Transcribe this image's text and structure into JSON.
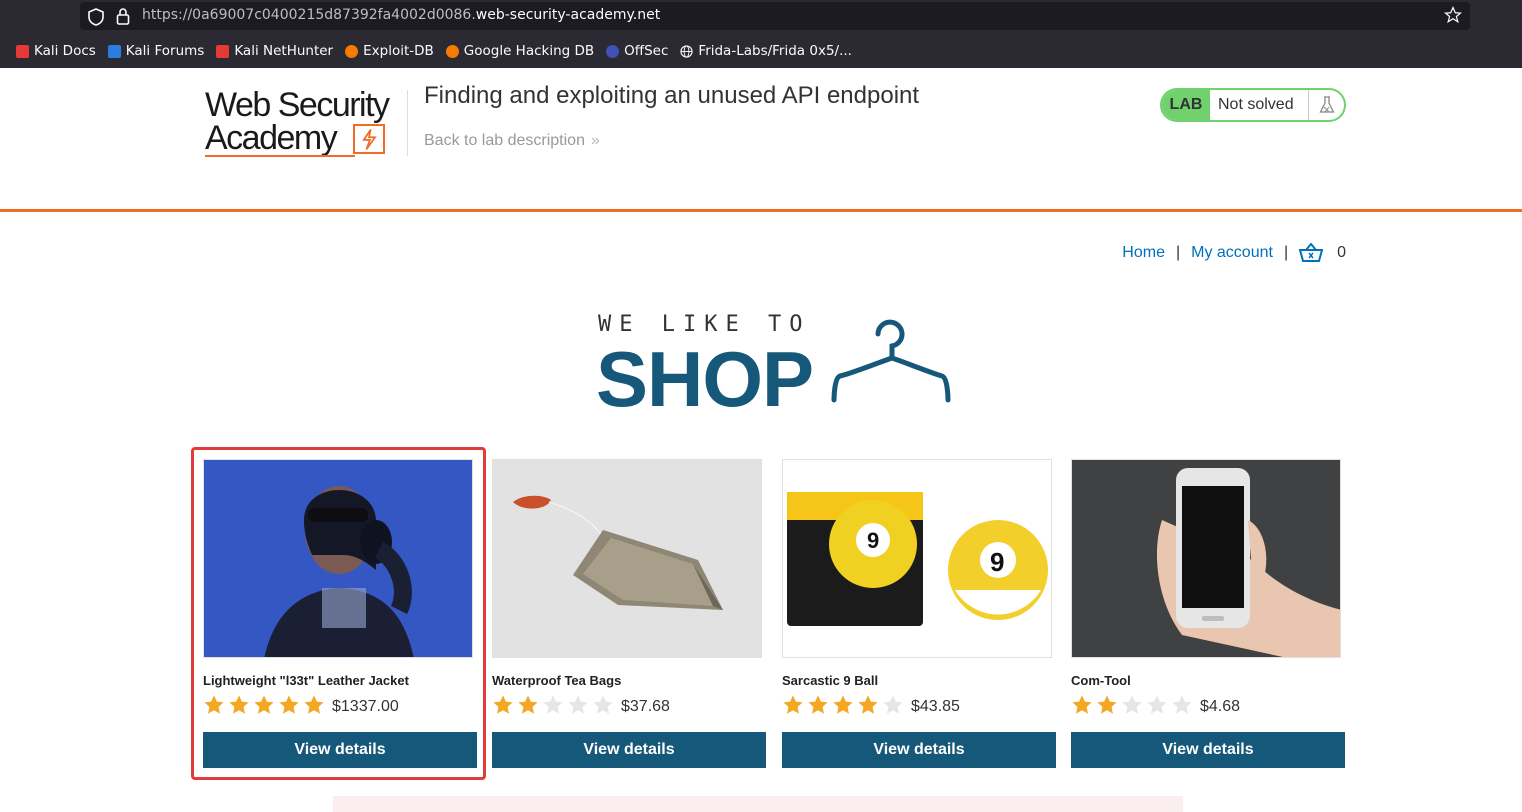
{
  "browser": {
    "url_prefix": "https://0a69007c0400215d87392fa4002d0086.",
    "url_host": "web-security-academy.net",
    "bookmarks": [
      {
        "label": "Kali Docs",
        "color": "#e53935"
      },
      {
        "label": "Kali Forums",
        "color": "#2a7de1"
      },
      {
        "label": "Kali NetHunter",
        "color": "#e53935"
      },
      {
        "label": "Exploit-DB",
        "color": "#f57c00"
      },
      {
        "label": "Google Hacking DB",
        "color": "#f57c00"
      },
      {
        "label": "OffSec",
        "color": "#3f51b5"
      },
      {
        "label": "Frida-Labs/Frida 0x5/...",
        "color": "#cccccc"
      }
    ]
  },
  "header": {
    "logo_line1": "Web Security",
    "logo_line2": "Academy",
    "lab_title": "Finding and exploiting an unused API endpoint",
    "back_link": "Back to lab description",
    "status_tag": "LAB",
    "status_text": "Not solved"
  },
  "nav": {
    "home": "Home",
    "my_account": "My account",
    "separator": "|",
    "cart_count": "0"
  },
  "hero": {
    "small": "WE LIKE TO",
    "big": "SHOP"
  },
  "products": [
    {
      "name": "Lightweight \"l33t\" Leather Jacket",
      "rating": 5,
      "price": "$1337.00",
      "button": "View details",
      "image": "headphones-woman"
    },
    {
      "name": "Waterproof Tea Bags",
      "rating": 2,
      "price": "$37.68",
      "button": "View details",
      "image": "tea-bag"
    },
    {
      "name": "Sarcastic 9 Ball",
      "rating": 4,
      "price": "$43.85",
      "button": "View details",
      "image": "nine-ball"
    },
    {
      "name": "Com-Tool",
      "rating": 2,
      "price": "$4.68",
      "button": "View details",
      "image": "phone-hand"
    }
  ],
  "colors": {
    "accent_orange": "#f06c24",
    "button_blue": "#15587a",
    "link_blue": "#0071bc",
    "status_green": "#70d16d",
    "star_gold": "#f5a623",
    "highlight_red": "#e03c3c"
  }
}
